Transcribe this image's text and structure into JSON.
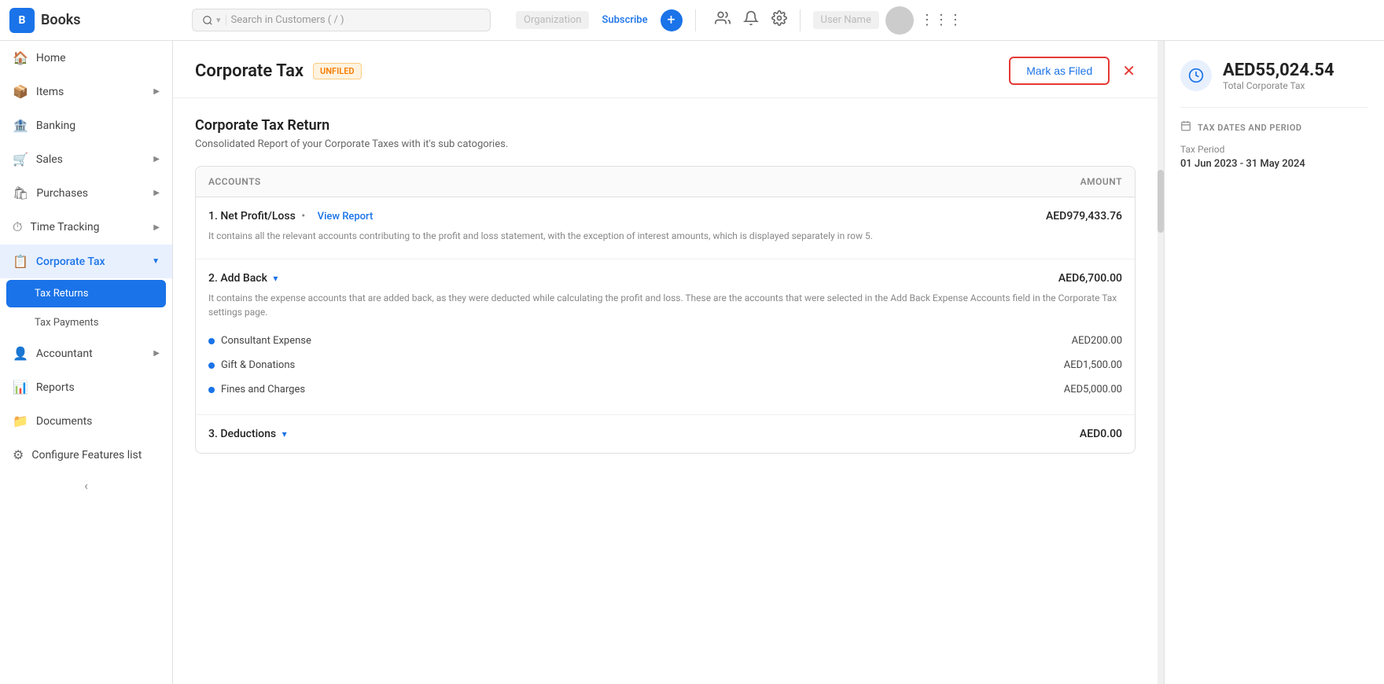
{
  "app": {
    "name": "Books",
    "logo_letter": "B"
  },
  "topbar": {
    "search_placeholder": "Search in Customers ( / )",
    "subscribe_label": "Subscribe",
    "plus_icon": "+",
    "org_name": "Organization",
    "user_name": "User Name"
  },
  "sidebar": {
    "items": [
      {
        "id": "home",
        "label": "Home",
        "icon": "🏠",
        "has_children": false
      },
      {
        "id": "items",
        "label": "Items",
        "icon": "📦",
        "has_children": true
      },
      {
        "id": "banking",
        "label": "Banking",
        "icon": "🏦",
        "has_children": false
      },
      {
        "id": "sales",
        "label": "Sales",
        "icon": "🛒",
        "has_children": true
      },
      {
        "id": "purchases",
        "label": "Purchases",
        "icon": "🛍",
        "has_children": true
      },
      {
        "id": "time-tracking",
        "label": "Time Tracking",
        "icon": "⏱",
        "has_children": true
      },
      {
        "id": "corporate-tax",
        "label": "Corporate Tax",
        "icon": "📋",
        "has_children": true,
        "active": true
      },
      {
        "id": "accountant",
        "label": "Accountant",
        "icon": "👤",
        "has_children": true
      },
      {
        "id": "reports",
        "label": "Reports",
        "icon": "📊",
        "has_children": false
      },
      {
        "id": "documents",
        "label": "Documents",
        "icon": "📁",
        "has_children": false
      },
      {
        "id": "configure",
        "label": "Configure Features list",
        "icon": "⚙",
        "has_children": false
      }
    ],
    "sub_items": [
      {
        "id": "tax-returns",
        "label": "Tax Returns",
        "active": true
      },
      {
        "id": "tax-payments",
        "label": "Tax Payments",
        "active": false
      }
    ],
    "collapse_label": "‹"
  },
  "header": {
    "title": "Corporate Tax",
    "badge": "UNFILED",
    "mark_filed_label": "Mark as Filed",
    "close_icon": "✕"
  },
  "content": {
    "section_title": "Corporate Tax Return",
    "section_subtitle": "Consolidated Report of your Corporate Taxes with it's sub catogories.",
    "table_header_accounts": "ACCOUNTS",
    "table_header_amount": "AMOUNT",
    "rows": [
      {
        "number": "1",
        "label": "Net Profit/Loss",
        "has_view_report": true,
        "view_report_label": "View Report",
        "amount": "AED979,433.76",
        "description": "It contains all the relevant accounts contributing to the profit and loss statement, with the exception of interest amounts, which is displayed separately in row 5.",
        "sub_items": []
      },
      {
        "number": "2",
        "label": "Add Back",
        "has_chevron": true,
        "amount": "AED6,700.00",
        "description": "It contains the expense accounts that are added back, as they were deducted while calculating the profit and loss. These are the accounts that were selected in the Add Back Expense Accounts field in the Corporate Tax settings page.",
        "sub_items": [
          {
            "label": "Consultant Expense",
            "amount": "AED200.00"
          },
          {
            "label": "Gift & Donations",
            "amount": "AED1,500.00"
          },
          {
            "label": "Fines and Charges",
            "amount": "AED5,000.00"
          }
        ]
      }
    ],
    "deductions_label": "3. Deductions",
    "deductions_has_chevron": true,
    "deductions_amount": "AED0.00"
  },
  "right_panel": {
    "total_amount": "AED55,024.54",
    "total_label": "Total Corporate Tax",
    "tax_dates_label": "TAX DATES AND PERIOD",
    "tax_period_title": "Tax Period",
    "tax_period_value": "01 Jun 2023 - 31 May 2024"
  }
}
